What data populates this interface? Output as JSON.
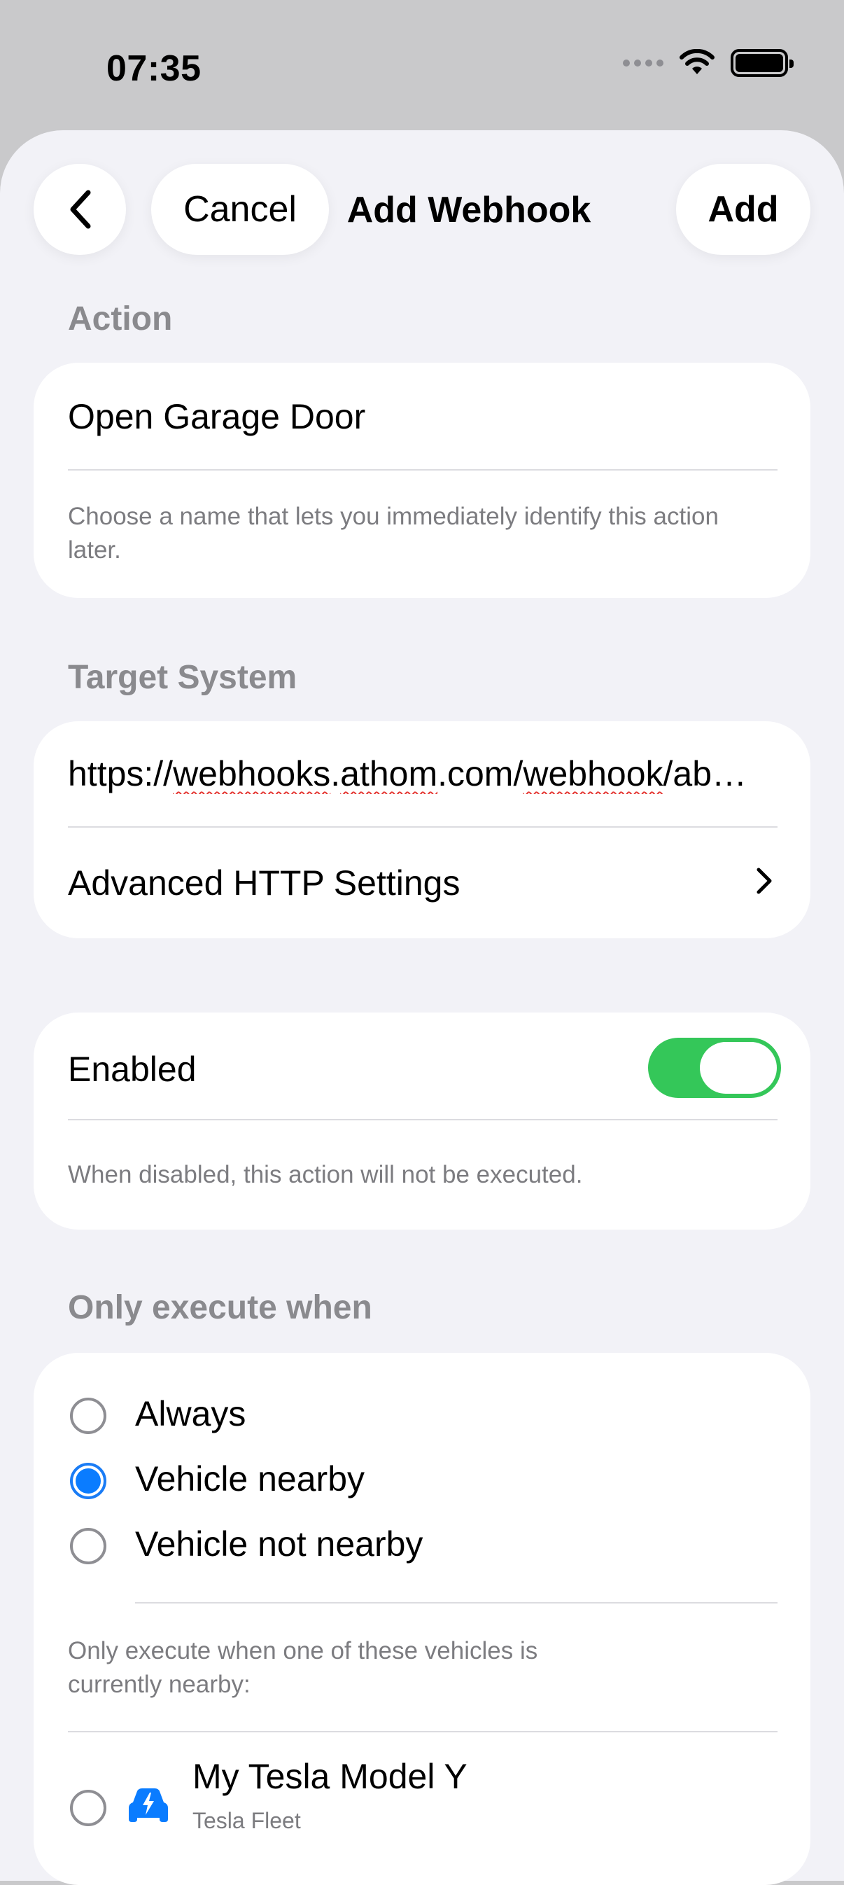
{
  "status_bar": {
    "time": "07:35"
  },
  "nav": {
    "cancel_label": "Cancel",
    "title": "Add Webhook",
    "add_label": "Add"
  },
  "action_section": {
    "label": "Action",
    "name_value": "Open Garage Door",
    "footnote": "Choose a name that lets you immediately identify this action later."
  },
  "target_section": {
    "label": "Target System",
    "url_parts": {
      "scheme": "https://",
      "host_a": "webhooks",
      "dot1": ".",
      "host_b": "athom",
      "host_c": ".com/",
      "path_a": "webhook",
      "path_b": "/ab…"
    },
    "advanced_label": "Advanced HTTP Settings"
  },
  "enabled_section": {
    "label": "Enabled",
    "enabled": true,
    "footnote": "When disabled, this action will not be executed."
  },
  "condition_section": {
    "label": "Only execute when",
    "options": [
      "Always",
      "Vehicle nearby",
      "Vehicle not nearby"
    ],
    "selected_option": "Vehicle nearby",
    "vehicles_footnote": "Only execute when one of these vehicles is currently nearby:",
    "vehicles": [
      {
        "name": "My Tesla Model Y",
        "subtitle": "Tesla Fleet",
        "selected": false
      }
    ]
  },
  "colors": {
    "accent": "#0a7cff",
    "toggle_on": "#34c759",
    "background": "#f2f2f7",
    "spell_underline": "#e53935"
  }
}
